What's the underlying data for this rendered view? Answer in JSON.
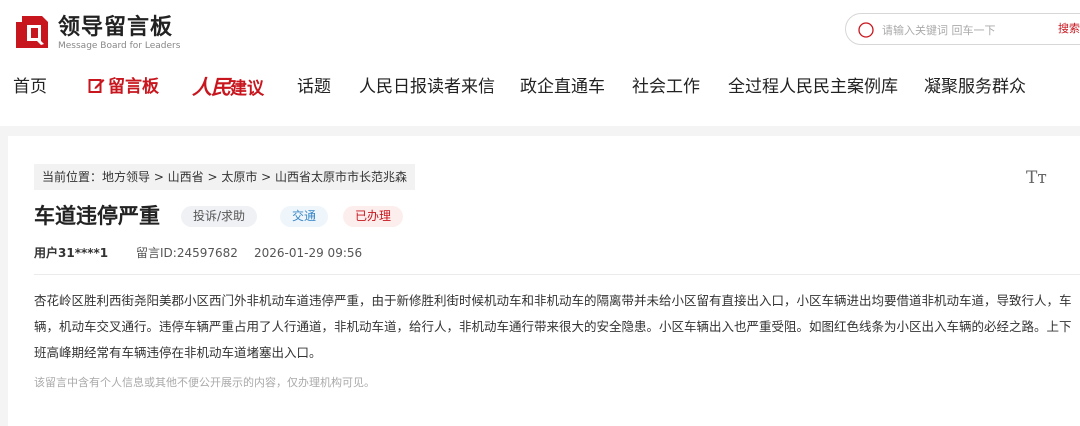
{
  "header": {
    "logo_title": "领导留言板",
    "logo_subtitle": "Message Board for Leaders",
    "search": {
      "placeholder": "请输入关键词 回车一下",
      "button": "搜索"
    }
  },
  "nav": {
    "items": [
      {
        "label": "首页"
      },
      {
        "label": "留言板",
        "active": true
      },
      {
        "label_script": "人民",
        "label_text": "建议"
      },
      {
        "label": "话题"
      },
      {
        "label": "人民日报读者来信"
      },
      {
        "label": "政企直通车"
      },
      {
        "label": "社会工作"
      },
      {
        "label": "全过程人民民主案例库"
      },
      {
        "label": "凝聚服务群众"
      }
    ]
  },
  "breadcrumb": "当前位置：地方领导 > 山西省 > 太原市 > 山西省太原市市长范兆森",
  "font_size_icon": "Tт",
  "message": {
    "title": "车道违停严重",
    "tags": {
      "type": "投诉/求助",
      "domain": "交通",
      "status": "已办理"
    },
    "user": "用户31****1",
    "message_id": "留言ID:24597682",
    "date": "2026-01-29 09:56",
    "content": "杏花岭区胜利西街尧阳美郡小区西门外非机动车道违停严重，由于新修胜利街时候机动车和非机动车的隔离带并未给小区留有直接出入口，小区车辆进出均要借道非机动车道，导致行人，车辆，机动车交叉通行。违停车辆严重占用了人行通道，非机动车道，给行人，非机动车通行带来很大的安全隐患。小区车辆出入也严重受阻。如图红色线条为小区出入车辆的必经之路。上下班高峰期经常有车辆违停在非机动车道堵塞出入口。",
    "notice": "该留言中含有个人信息或其他不便公开展示的内容，仅办理机构可见。"
  },
  "colors": {
    "brand_red": "#c8161e",
    "domain_blue": "#3a87c8"
  }
}
